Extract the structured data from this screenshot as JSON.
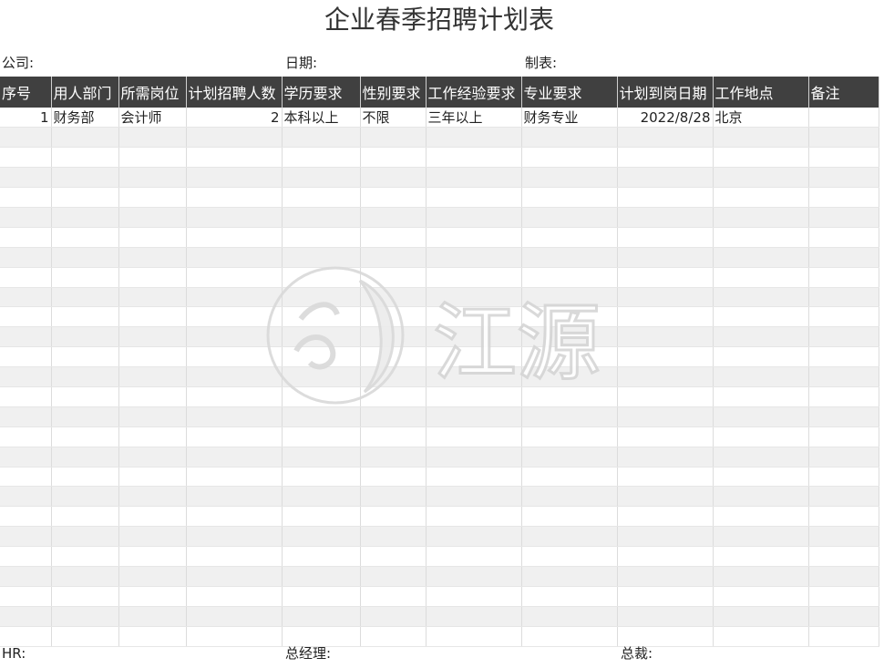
{
  "title": "企业春季招聘计划表",
  "meta": {
    "company": "公司:",
    "date": "日期:",
    "made_by": "制表:"
  },
  "columns": [
    "序号",
    "用人部门",
    "所需岗位",
    "计划招聘人数",
    "学历要求",
    "性别要求",
    "工作经验要求",
    "专业要求",
    "计划到岗日期",
    "工作地点",
    "备注"
  ],
  "rows": [
    [
      "1",
      "财务部",
      "会计师",
      "2",
      "本科以上",
      "不限",
      "三年以上",
      "财务专业",
      "2022/8/28",
      "北京",
      ""
    ],
    [
      "",
      "",
      "",
      "",
      "",
      "",
      "",
      "",
      "",
      "",
      ""
    ],
    [
      "",
      "",
      "",
      "",
      "",
      "",
      "",
      "",
      "",
      "",
      ""
    ],
    [
      "",
      "",
      "",
      "",
      "",
      "",
      "",
      "",
      "",
      "",
      ""
    ],
    [
      "",
      "",
      "",
      "",
      "",
      "",
      "",
      "",
      "",
      "",
      ""
    ],
    [
      "",
      "",
      "",
      "",
      "",
      "",
      "",
      "",
      "",
      "",
      ""
    ],
    [
      "",
      "",
      "",
      "",
      "",
      "",
      "",
      "",
      "",
      "",
      ""
    ],
    [
      "",
      "",
      "",
      "",
      "",
      "",
      "",
      "",
      "",
      "",
      ""
    ],
    [
      "",
      "",
      "",
      "",
      "",
      "",
      "",
      "",
      "",
      "",
      ""
    ],
    [
      "",
      "",
      "",
      "",
      "",
      "",
      "",
      "",
      "",
      "",
      ""
    ],
    [
      "",
      "",
      "",
      "",
      "",
      "",
      "",
      "",
      "",
      "",
      ""
    ],
    [
      "",
      "",
      "",
      "",
      "",
      "",
      "",
      "",
      "",
      "",
      ""
    ],
    [
      "",
      "",
      "",
      "",
      "",
      "",
      "",
      "",
      "",
      "",
      ""
    ],
    [
      "",
      "",
      "",
      "",
      "",
      "",
      "",
      "",
      "",
      "",
      ""
    ],
    [
      "",
      "",
      "",
      "",
      "",
      "",
      "",
      "",
      "",
      "",
      ""
    ],
    [
      "",
      "",
      "",
      "",
      "",
      "",
      "",
      "",
      "",
      "",
      ""
    ],
    [
      "",
      "",
      "",
      "",
      "",
      "",
      "",
      "",
      "",
      "",
      ""
    ],
    [
      "",
      "",
      "",
      "",
      "",
      "",
      "",
      "",
      "",
      "",
      ""
    ],
    [
      "",
      "",
      "",
      "",
      "",
      "",
      "",
      "",
      "",
      "",
      ""
    ],
    [
      "",
      "",
      "",
      "",
      "",
      "",
      "",
      "",
      "",
      "",
      ""
    ],
    [
      "",
      "",
      "",
      "",
      "",
      "",
      "",
      "",
      "",
      "",
      ""
    ],
    [
      "",
      "",
      "",
      "",
      "",
      "",
      "",
      "",
      "",
      "",
      ""
    ],
    [
      "",
      "",
      "",
      "",
      "",
      "",
      "",
      "",
      "",
      "",
      ""
    ],
    [
      "",
      "",
      "",
      "",
      "",
      "",
      "",
      "",
      "",
      "",
      ""
    ],
    [
      "",
      "",
      "",
      "",
      "",
      "",
      "",
      "",
      "",
      "",
      ""
    ],
    [
      "",
      "",
      "",
      "",
      "",
      "",
      "",
      "",
      "",
      "",
      ""
    ],
    [
      "",
      "",
      "",
      "",
      "",
      "",
      "",
      "",
      "",
      "",
      ""
    ]
  ],
  "footer": {
    "hr": "HR:",
    "gm": "总经理:",
    "president": "总裁:"
  },
  "watermark": {
    "text": "江源",
    "icon": "jiangyuan-logo-icon",
    "color": "#d8d8d8"
  },
  "colors": {
    "header_bg": "#404040",
    "header_text": "#ffffff",
    "stripe": "#f0f0f0"
  }
}
